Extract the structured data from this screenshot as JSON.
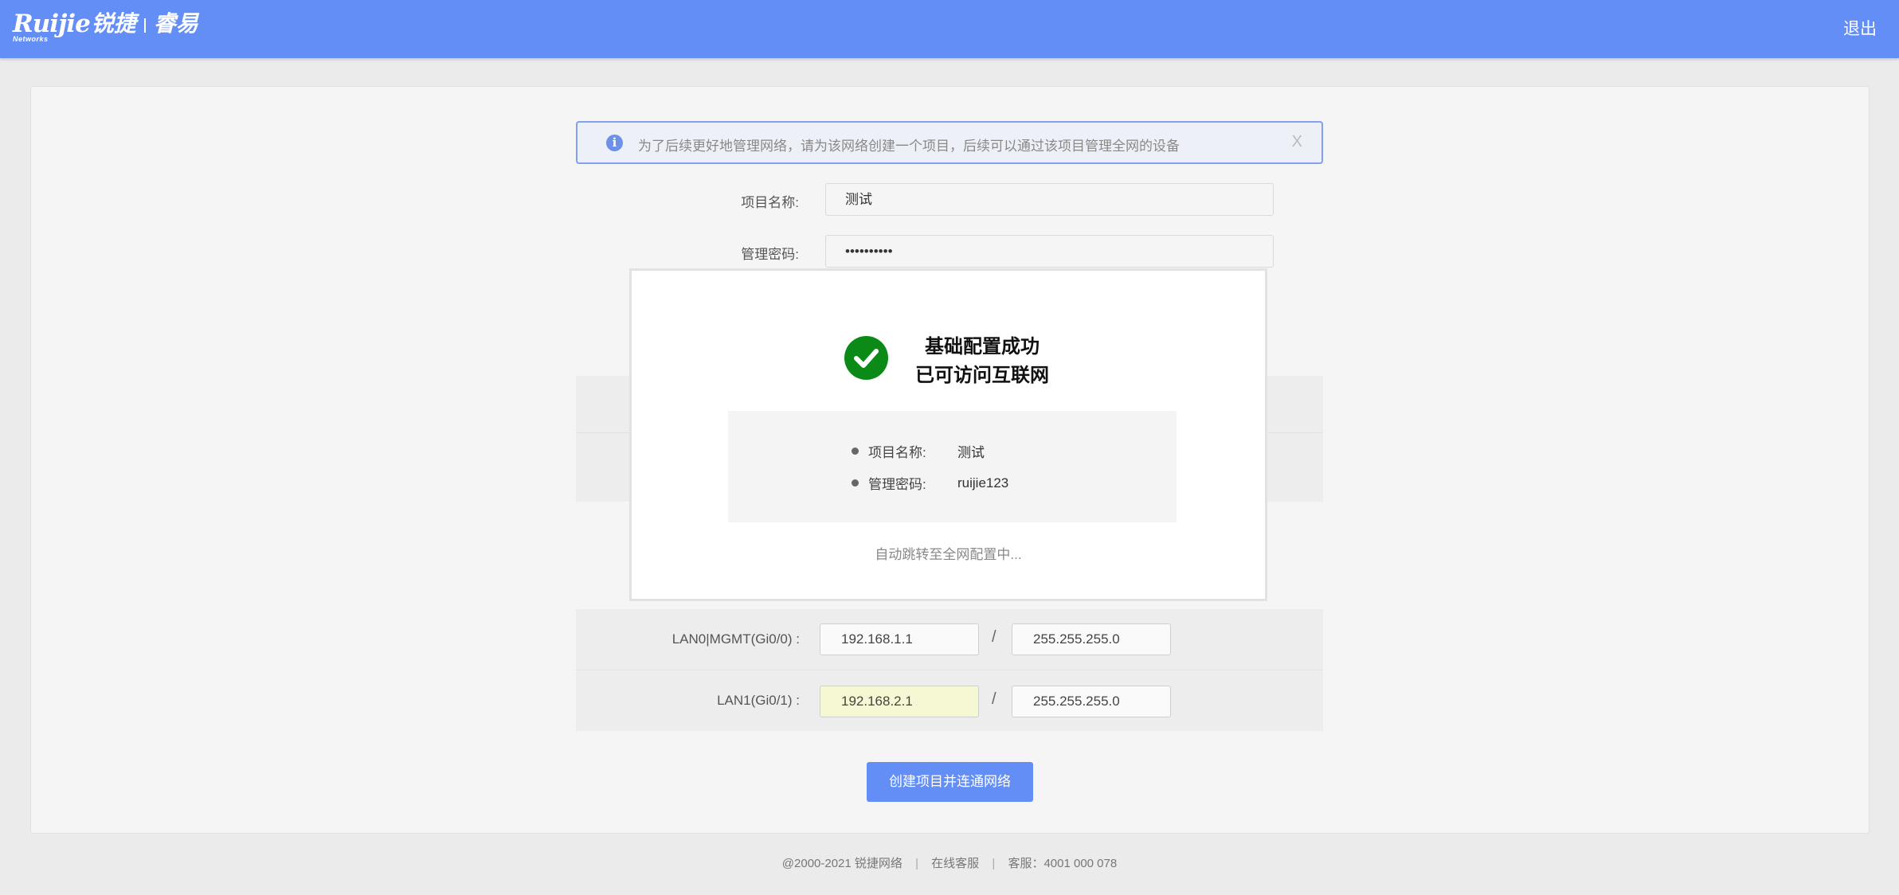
{
  "header": {
    "brand": "Ruijie",
    "brand_sub": "Networks",
    "brand_cn": "锐捷",
    "product": "睿易",
    "logout": "退出"
  },
  "alert": {
    "icon": "info-icon",
    "text": "为了后续更好地管理网络，请为该网络创建一个项目，后续可以通过该项目管理全网的设备",
    "close": "X"
  },
  "form": {
    "project_name_label": "项目名称:",
    "project_name_value": "测试",
    "password_label": "管理密码:",
    "password_value": "••••••••••"
  },
  "interfaces": [
    {
      "label": "LAN0|MGMT(Gi0/0) :",
      "ip": "192.168.1.1",
      "mask": "255.255.255.0"
    },
    {
      "label": "LAN1(Gi0/1) :",
      "ip": "192.168.2.1",
      "mask": "255.255.255.0"
    }
  ],
  "slash": "/",
  "submit_button": "创建项目并连通网络",
  "footer": {
    "copyright": "@2000-2021 锐捷网络",
    "online_service": "在线客服",
    "hotline": "客服：4001 000 078"
  },
  "modal": {
    "title_line1": "基础配置成功",
    "title_line2": "已可访问互联网",
    "project_name_label": "项目名称:",
    "project_name_value": "测试",
    "password_label": "管理密码:",
    "password_value": "ruijie123",
    "redirect_text": "自动跳转至全网配置中..."
  },
  "colors": {
    "header": "#638ef6",
    "success": "#0b8a18",
    "highlight_input": "#f6f8d4"
  }
}
